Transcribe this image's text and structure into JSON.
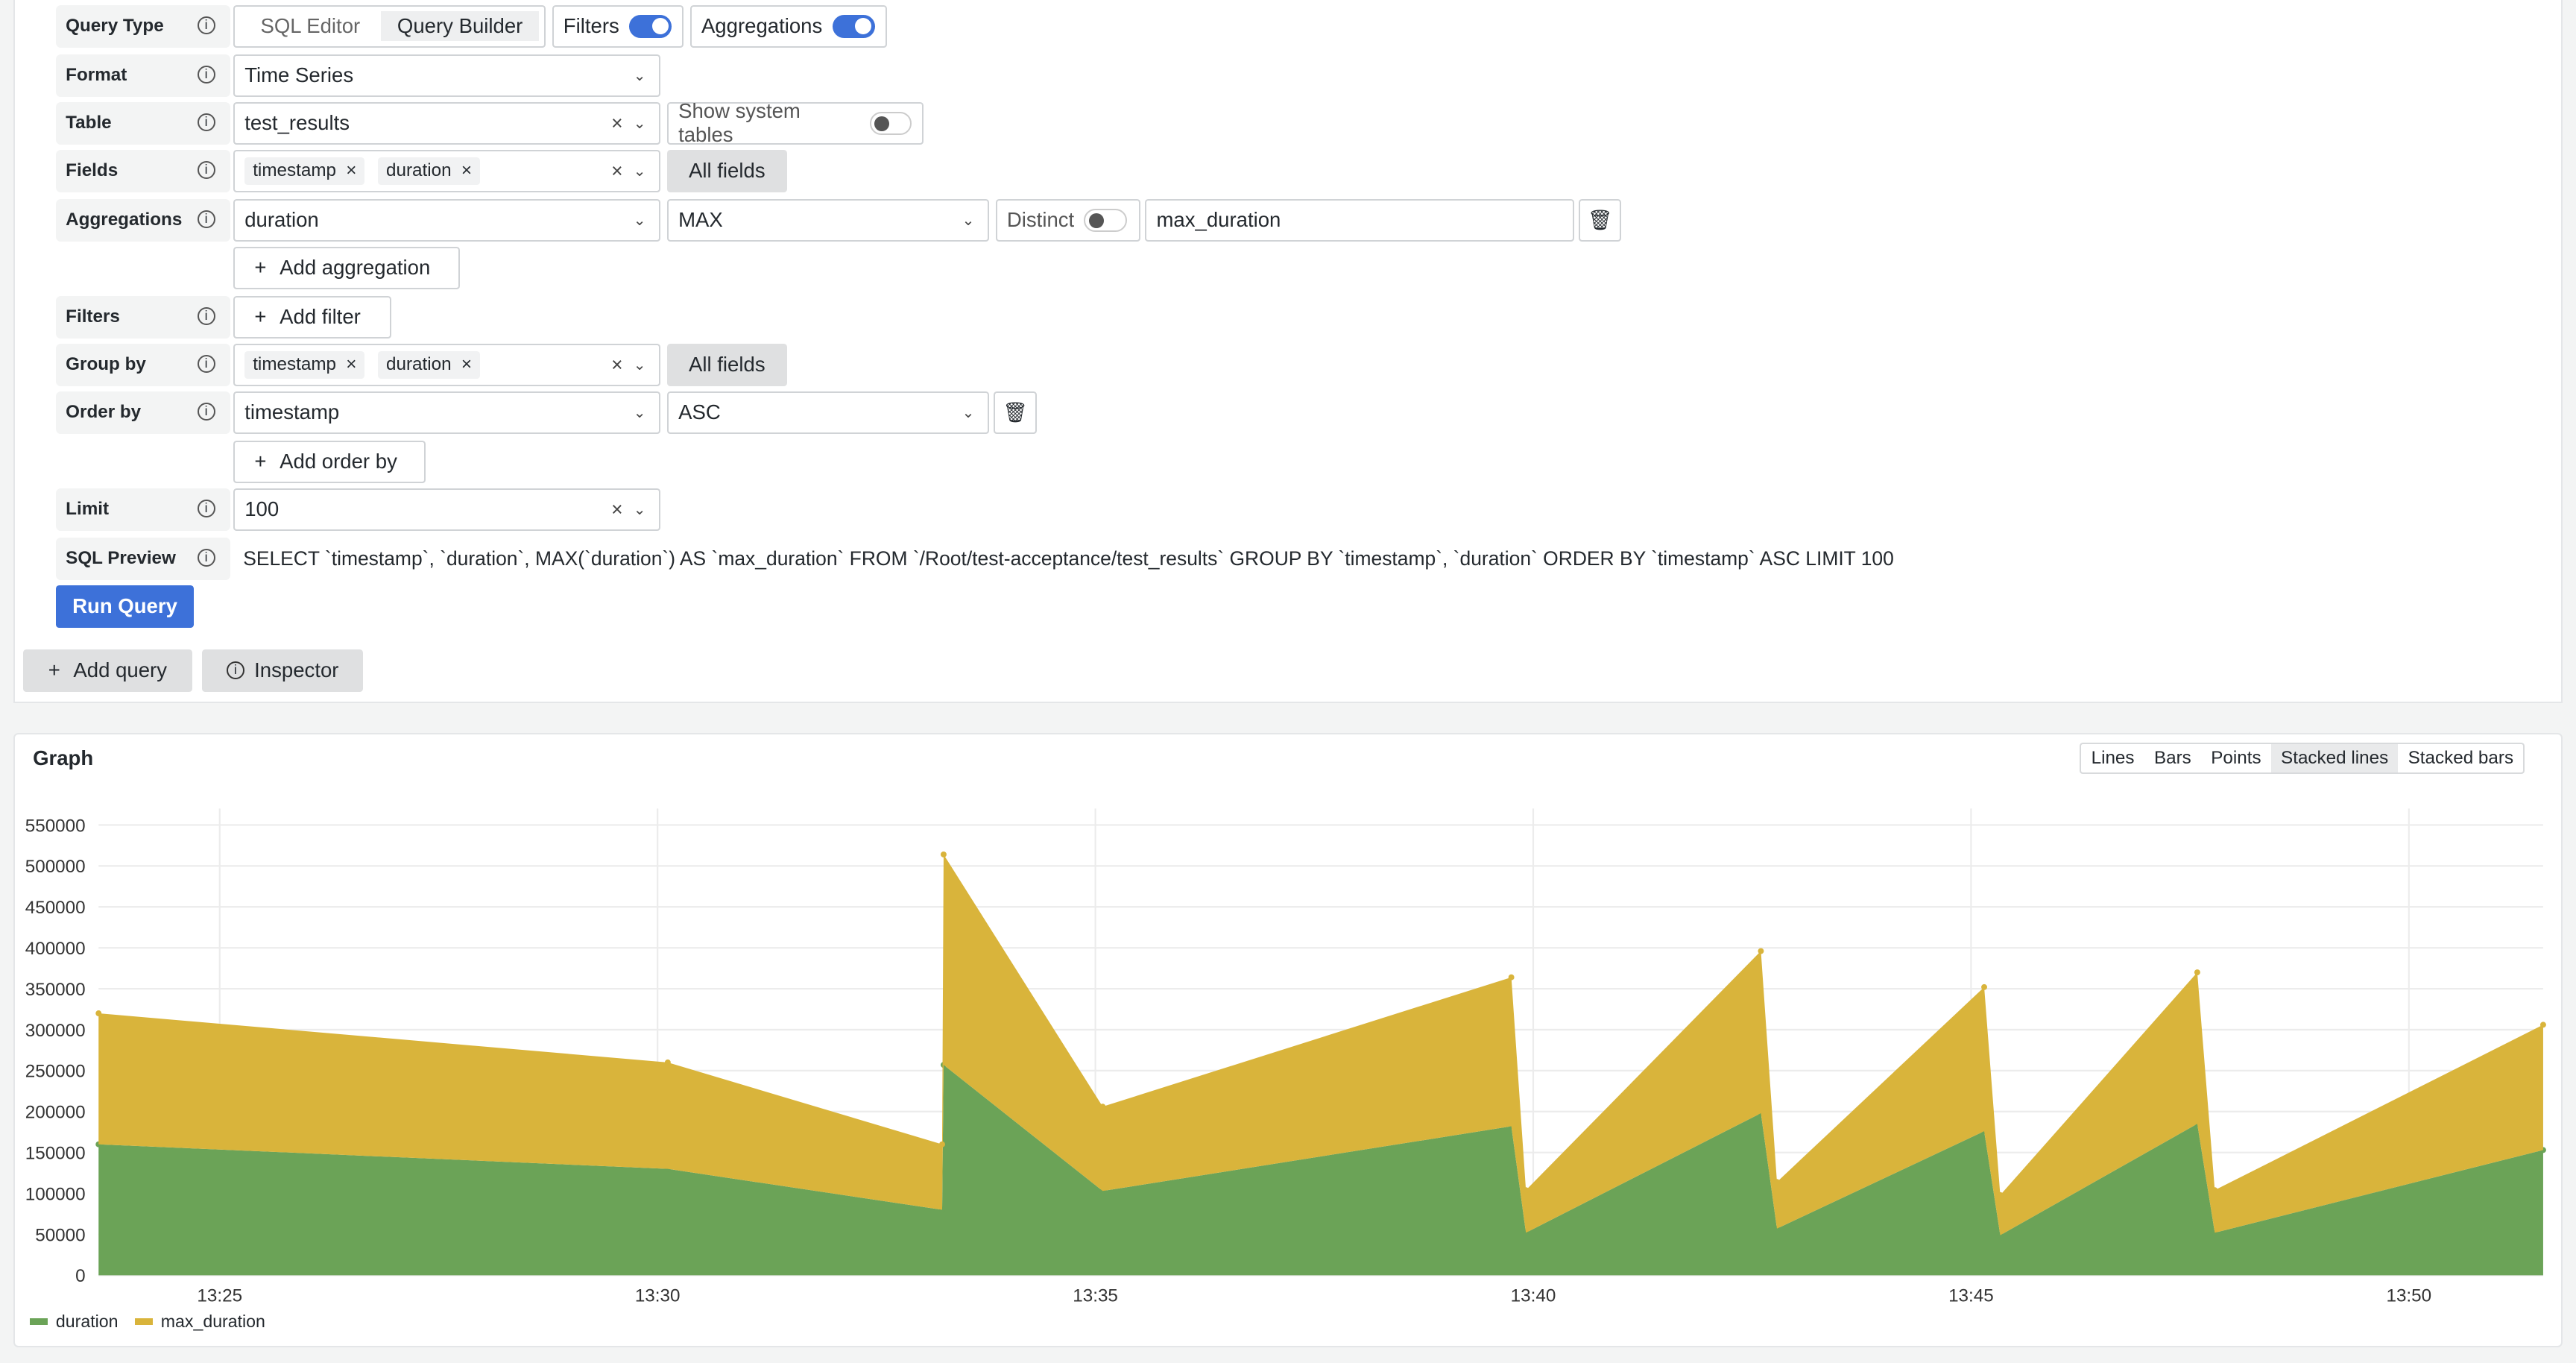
{
  "query": {
    "query_type": {
      "label": "Query Type",
      "options": [
        "SQL Editor",
        "Query Builder"
      ],
      "selected": "Query Builder",
      "filters_label": "Filters",
      "filters_on": true,
      "aggregations_label": "Aggregations",
      "aggregations_on": true
    },
    "format": {
      "label": "Format",
      "value": "Time Series"
    },
    "table": {
      "label": "Table",
      "value": "test_results",
      "system_label": "Show system tables",
      "system_on": false
    },
    "fields": {
      "label": "Fields",
      "chips": [
        "timestamp",
        "duration"
      ],
      "all_fields": "All fields"
    },
    "aggregations": {
      "label": "Aggregations",
      "field": "duration",
      "func": "MAX",
      "distinct_label": "Distinct",
      "distinct_on": false,
      "alias": "max_duration",
      "add_label": "Add aggregation"
    },
    "filters": {
      "label": "Filters",
      "add_label": "Add filter"
    },
    "group_by": {
      "label": "Group by",
      "chips": [
        "timestamp",
        "duration"
      ],
      "all_fields": "All fields"
    },
    "order_by": {
      "label": "Order by",
      "field": "timestamp",
      "dir": "ASC",
      "add_label": "Add order by"
    },
    "limit": {
      "label": "Limit",
      "value": "100"
    },
    "sql_preview": {
      "label": "SQL Preview",
      "value": "SELECT `timestamp`, `duration`, MAX(`duration`) AS `max_duration` FROM `/Root/test-acceptance/test_results` GROUP BY `timestamp`, `duration` ORDER BY `timestamp` ASC LIMIT 100"
    },
    "run_label": "Run Query",
    "add_query_label": "Add query",
    "inspector_label": "Inspector",
    "info_glyph": "i"
  },
  "graph": {
    "title": "Graph",
    "modes": [
      "Lines",
      "Bars",
      "Points",
      "Stacked lines",
      "Stacked bars"
    ],
    "selected_mode": "Stacked lines"
  },
  "colors": {
    "accent": "#3d71d9",
    "duration": "#6ba357",
    "max_duration": "#d9b43b"
  },
  "chart_data": {
    "type": "area",
    "stacked": true,
    "x": [
      "13:23:37",
      "13:30:07",
      "13:33:15",
      "13:33:16",
      "13:35:05",
      "13:39:45",
      "13:39:55",
      "13:42:36",
      "13:42:47",
      "13:45:09",
      "13:45:20",
      "13:47:35",
      "13:47:47",
      "13:51:32"
    ],
    "series": [
      {
        "name": "duration",
        "values": [
          160000,
          130000,
          80000,
          257000,
          103000,
          182000,
          52000,
          198000,
          57000,
          176000,
          49000,
          185000,
          52000,
          153000
        ]
      },
      {
        "name": "max_duration",
        "values": [
          160000,
          130000,
          80000,
          257000,
          103000,
          182000,
          52000,
          198000,
          57000,
          176000,
          49000,
          185000,
          52000,
          153000
        ]
      }
    ],
    "xticks": [
      "13:25",
      "13:30",
      "13:35",
      "13:40",
      "13:45",
      "13:50"
    ],
    "yticks": [
      "0",
      "50000",
      "100000",
      "150000",
      "200000",
      "250000",
      "300000",
      "350000",
      "400000",
      "450000",
      "500000",
      "550000"
    ],
    "ylim": [
      0,
      550000
    ],
    "grid": true,
    "legend": "bottom-left"
  }
}
